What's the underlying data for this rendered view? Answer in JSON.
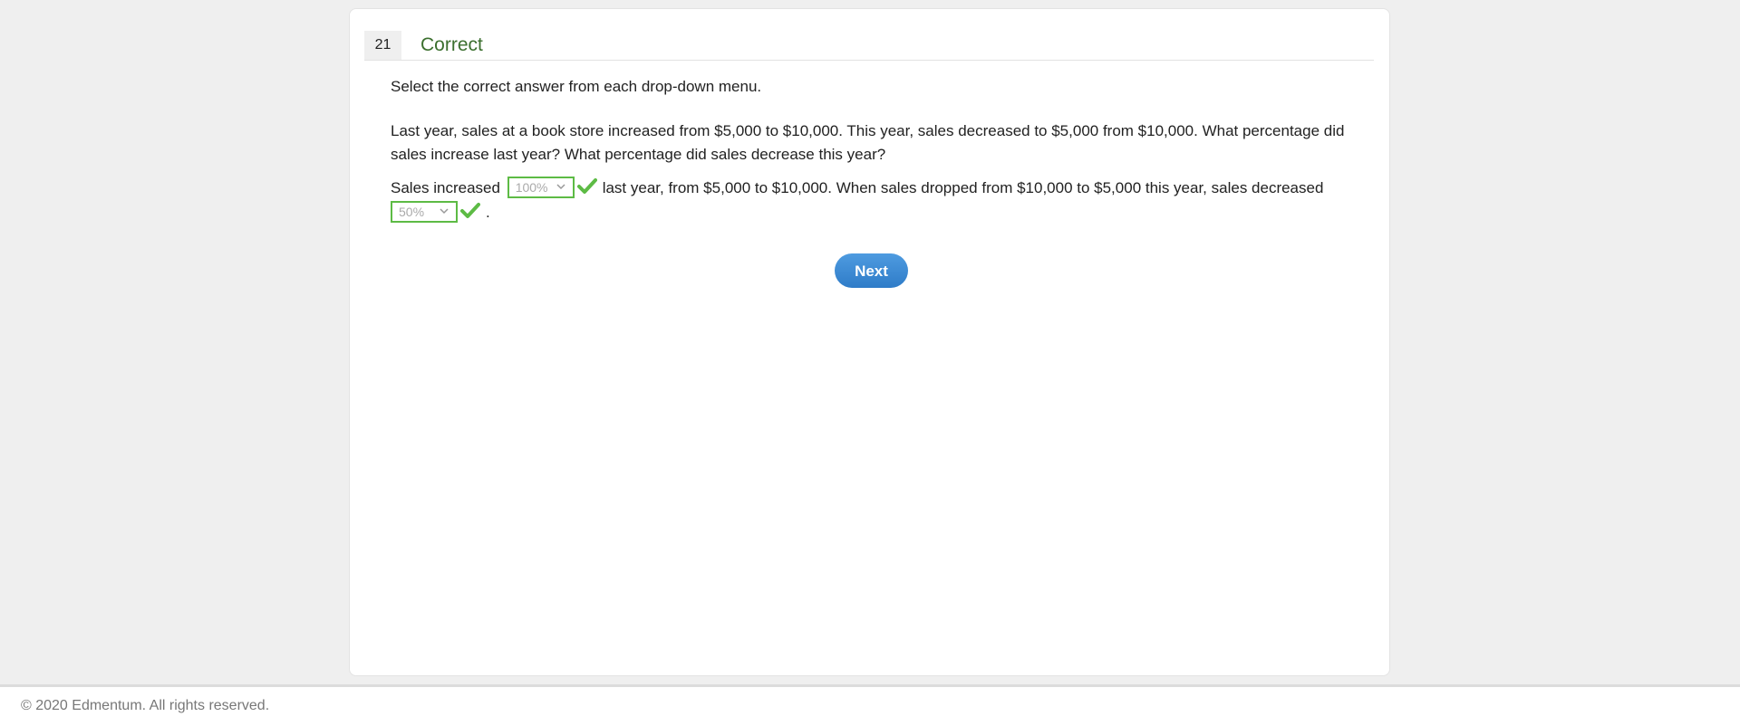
{
  "question": {
    "number": "21",
    "status": "Correct",
    "instructions": "Select the correct answer from each drop-down menu.",
    "text": "Last year, sales at a book store increased from $5,000 to $10,000. This year, sales decreased to $5,000 from $10,000. What percentage did sales increase last year? What percentage did sales decrease this year?",
    "answer": {
      "prefix": "Sales increased",
      "dropdown1_value": "100%",
      "middle": "last year, from $5,000 to $10,000. When sales dropped from $10,000 to $5,000 this year, sales decreased",
      "dropdown2_value": "50%",
      "suffix": "."
    }
  },
  "buttons": {
    "next_label": "Next"
  },
  "footer": {
    "copyright": "© 2020 Edmentum. All rights reserved."
  },
  "colors": {
    "correct_green": "#5dbb45",
    "status_green": "#3b6f2e",
    "button_blue": "#3a88d4"
  },
  "icons": {
    "check": "check-icon",
    "dropdown": "chevron-down-icon"
  }
}
